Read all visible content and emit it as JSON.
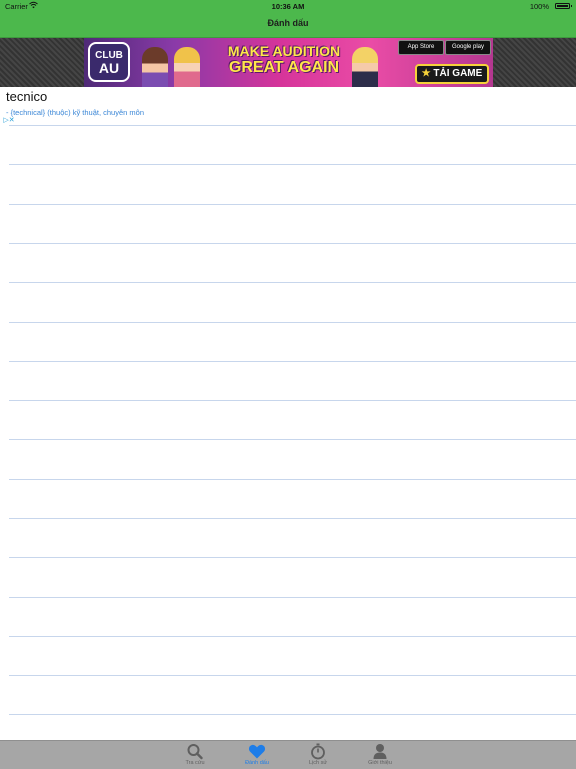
{
  "status_bar": {
    "carrier": "Carrier",
    "time": "10:36 AM",
    "battery": "100%"
  },
  "nav": {
    "title": "Đánh dấu"
  },
  "ad": {
    "logo_line1": "CLUB",
    "logo_line2": "AU",
    "headline_line1": "MAKE AUDITION",
    "headline_line2": "GREAT AGAIN",
    "app_store": "App Store",
    "google_play": "Google play",
    "cta": "TẢI GAME"
  },
  "entry": {
    "word": "tecnico",
    "definition": "- {technical} (thuộc) kỹ thuật, chuyên môn"
  },
  "tab_bar": {
    "tabs": [
      {
        "label": "Tra cứu",
        "icon": "search-icon",
        "active": false
      },
      {
        "label": "Đánh dấu",
        "icon": "heart-icon",
        "active": true
      },
      {
        "label": "Lịch sử",
        "icon": "stopwatch-icon",
        "active": false
      },
      {
        "label": "Giới thiệu",
        "icon": "person-icon",
        "active": false
      }
    ]
  },
  "colors": {
    "nav_green": "#4cb84c",
    "tab_active": "#1e7de8",
    "tab_inactive": "#5f5f5f",
    "definition_blue": "#3a86d6",
    "rule_line": "#c7d6ec"
  }
}
